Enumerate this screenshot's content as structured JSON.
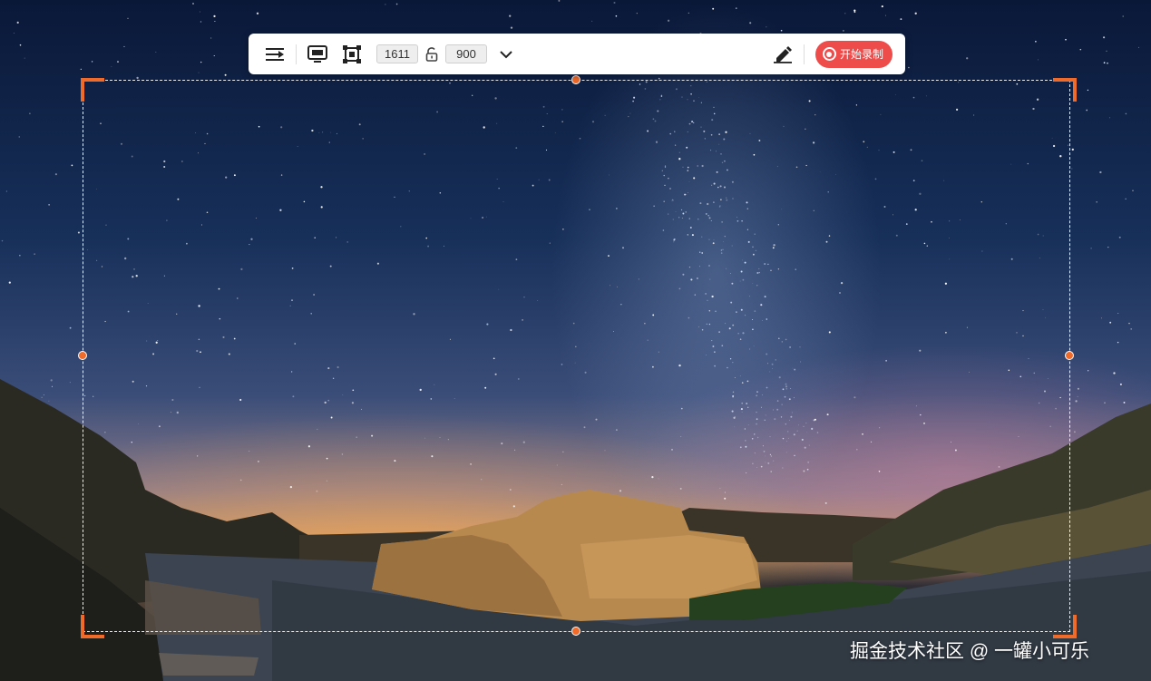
{
  "toolbar": {
    "width_value": "1611",
    "height_value": "900",
    "record_label": "开始录制",
    "icons": {
      "menu": "align-right-icon",
      "screen": "monitor-icon",
      "region": "crop-frame-icon",
      "lock": "unlock-icon",
      "dropdown": "chevron-down-icon",
      "annotate": "pen-eraser-icon",
      "record": "record-circle-icon"
    }
  },
  "selection": {
    "accent_color": "#f06a2a"
  },
  "watermark": {
    "text": "掘金技术社区 @ 一罐小可乐"
  },
  "colors": {
    "record_button": "#ee4b4b",
    "toolbar_bg": "#ffffff"
  }
}
